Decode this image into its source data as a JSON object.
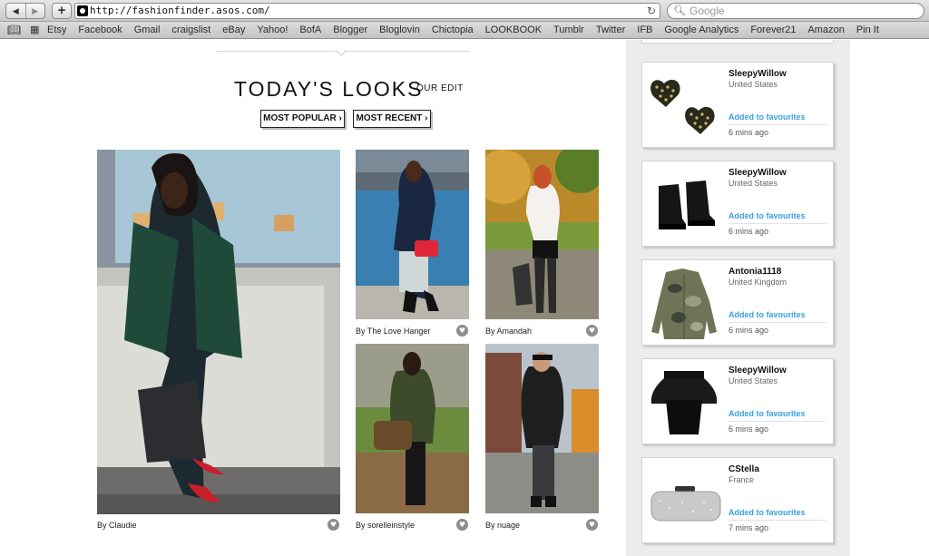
{
  "browser": {
    "url": "http://fashionfinder.asos.com/",
    "search_placeholder": "Google",
    "bookmarks": [
      "Etsy",
      "Facebook",
      "Gmail",
      "craigslist",
      "eBay",
      "Yahoo!",
      "BofA",
      "Blogger",
      "Bloglovin",
      "Chictopia",
      "LOOKBOOK",
      "Tumblr",
      "Twitter",
      "IFB",
      "Google Analytics",
      "Forever21",
      "Amazon",
      "Pin It"
    ]
  },
  "header": {
    "title": "TODAY'S LOOKS",
    "our_edit": "OUR EDIT",
    "most_popular": "MOST POPULAR ›",
    "most_recent": "MOST RECENT ›"
  },
  "looks": [
    {
      "caption": "By Claudie"
    },
    {
      "caption": "By The Love Hanger"
    },
    {
      "caption": "By Amandah"
    },
    {
      "caption": "By sorelleinstyle"
    },
    {
      "caption": "By nuage"
    }
  ],
  "feed": [
    {
      "user": "SleepyWillow",
      "country": "United States",
      "action": "Added to favourites",
      "time": "6 mins ago",
      "item": "heart-stud-earrings"
    },
    {
      "user": "SleepyWillow",
      "country": "United States",
      "action": "Added to favourites",
      "time": "6 mins ago",
      "item": "platform-ankle-boots"
    },
    {
      "user": "Antonia1118",
      "country": "United Kingdom",
      "action": "Added to favourites",
      "time": "6 mins ago",
      "item": "camo-shirt"
    },
    {
      "user": "SleepyWillow",
      "country": "United States",
      "action": "Added to favourites",
      "time": "6 mins ago",
      "item": "peplum-skirt"
    },
    {
      "user": "CStella",
      "country": "France",
      "action": "Added to favourites",
      "time": "7 mins ago",
      "item": "silver-clutch"
    }
  ],
  "colors": {
    "accent": "#3aa0e0",
    "feed_bg": "#ececec"
  }
}
